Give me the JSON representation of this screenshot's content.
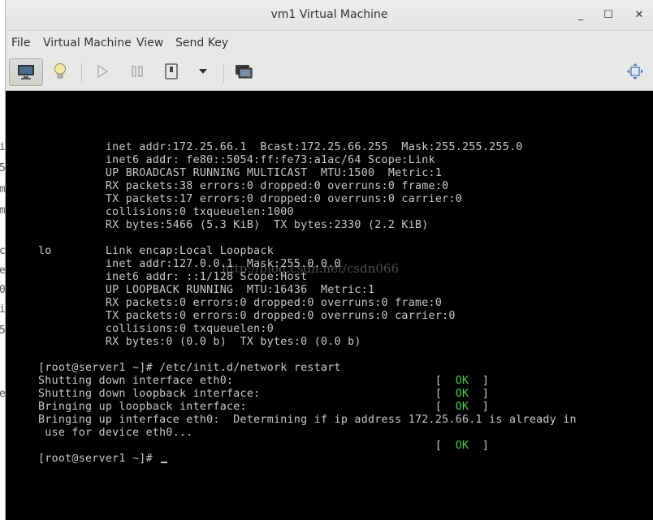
{
  "window": {
    "title": "vm1 Virtual Machine",
    "minimize_label": "_",
    "maximize_label": "☐",
    "close_label": "✕"
  },
  "menu": [
    "File",
    "Virtual Machine",
    "View",
    "Send Key"
  ],
  "toolbar": {
    "buttons": [
      "console-icon",
      "details-bulb-icon",
      "run-icon",
      "pause-icon",
      "shutdown-icon",
      "shutdown-menu-icon",
      "snapshots-icon",
      "fullscreen-icon"
    ]
  },
  "background_fragments": [
    "i",
    "5",
    "m",
    "m",
    "c",
    "e",
    "0",
    "i",
    "5",
    "e"
  ],
  "console": {
    "lines": [
      "          inet addr:172.25.66.1  Bcast:172.25.66.255  Mask:255.255.255.0",
      "          inet6 addr: fe80::5054:ff:fe73:a1ac/64 Scope:Link",
      "          UP BROADCAST RUNNING MULTICAST  MTU:1500  Metric:1",
      "          RX packets:38 errors:0 dropped:0 overruns:0 frame:0",
      "          TX packets:17 errors:0 dropped:0 overruns:0 carrier:0",
      "          collisions:0 txqueuelen:1000",
      "          RX bytes:5466 (5.3 KiB)  TX bytes:2330 (2.2 KiB)",
      "",
      "lo        Link encap:Local Loopback",
      "          inet addr:127.0.0.1  Mask:255.0.0.0",
      "          inet6 addr: ::1/128 Scope:Host",
      "          UP LOOPBACK RUNNING  MTU:16436  Metric:1",
      "          RX packets:0 errors:0 dropped:0 overruns:0 frame:0",
      "          TX packets:0 errors:0 dropped:0 overruns:0 carrier:0",
      "          collisions:0 txqueuelen:0",
      "          RX bytes:0 (0.0 b)  TX bytes:0 (0.0 b)",
      "",
      "[root@server1 ~]# /etc/init.d/network restart",
      "Shutting down interface eth0:                              [  ",
      "Shutting down loopback interface:                          [  ",
      "Bringing up loopback interface:                            [  ",
      "Bringing up interface eth0:  Determining if ip address 172.25.66.1 is already in",
      " use for device eth0...",
      "                                                           [  "
    ],
    "ok_label": "OK",
    "ok_suffix": "  ]",
    "prompt": "[root@server1 ~]# ",
    "watermark": "http://blog.csdn.net/csdn066"
  }
}
